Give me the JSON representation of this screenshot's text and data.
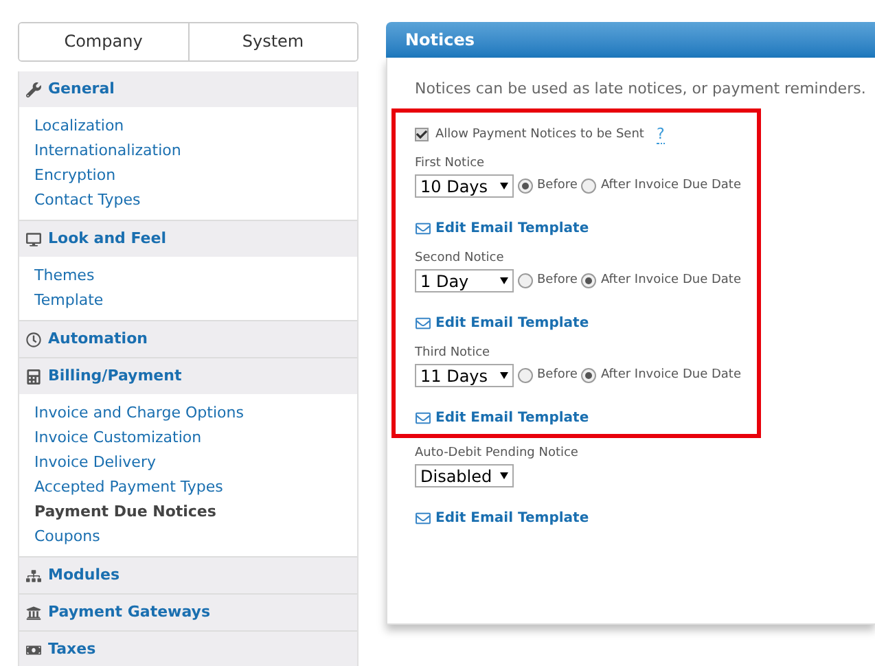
{
  "tabs": [
    {
      "label": "Company"
    },
    {
      "label": "System"
    }
  ],
  "sidebar": {
    "sections": [
      {
        "title": "General",
        "items": [
          {
            "label": "Localization",
            "selected": false
          },
          {
            "label": "Internationalization",
            "selected": false
          },
          {
            "label": "Encryption",
            "selected": false
          },
          {
            "label": "Contact Types",
            "selected": false
          }
        ]
      },
      {
        "title": "Look and Feel",
        "items": [
          {
            "label": "Themes",
            "selected": false
          },
          {
            "label": "Template",
            "selected": false
          }
        ]
      },
      {
        "title": "Automation"
      },
      {
        "title": "Billing/Payment",
        "items": [
          {
            "label": "Invoice and Charge Options",
            "selected": false
          },
          {
            "label": "Invoice Customization",
            "selected": false
          },
          {
            "label": "Invoice Delivery",
            "selected": false
          },
          {
            "label": "Accepted Payment Types",
            "selected": false
          },
          {
            "label": "Payment Due Notices",
            "selected": true
          },
          {
            "label": "Coupons",
            "selected": false
          }
        ]
      },
      {
        "title": "Modules"
      },
      {
        "title": "Payment Gateways"
      },
      {
        "title": "Taxes"
      }
    ]
  },
  "panel": {
    "title": "Notices",
    "description": "Notices can be used as late notices, or payment reminders.",
    "allow": {
      "label": "Allow Payment Notices to be Sent",
      "checked": true,
      "help": "?"
    },
    "notices": [
      {
        "label": "First Notice",
        "value": "10 Days",
        "options": [
          {
            "label": "Before",
            "selected": true
          },
          {
            "label": "After Invoice Due Date",
            "selected": false
          }
        ],
        "link": "Edit Email Template"
      },
      {
        "label": "Second Notice",
        "value": "1 Day",
        "options": [
          {
            "label": "Before",
            "selected": false
          },
          {
            "label": "After Invoice Due Date",
            "selected": true
          }
        ],
        "link": "Edit Email Template"
      },
      {
        "label": "Third Notice",
        "value": "11 Days",
        "options": [
          {
            "label": "Before",
            "selected": false
          },
          {
            "label": "After Invoice Due Date",
            "selected": true
          }
        ],
        "link": "Edit Email Template"
      }
    ],
    "auto_debit": {
      "label": "Auto-Debit Pending Notice",
      "value": "Disabled",
      "link": "Edit Email Template"
    }
  }
}
